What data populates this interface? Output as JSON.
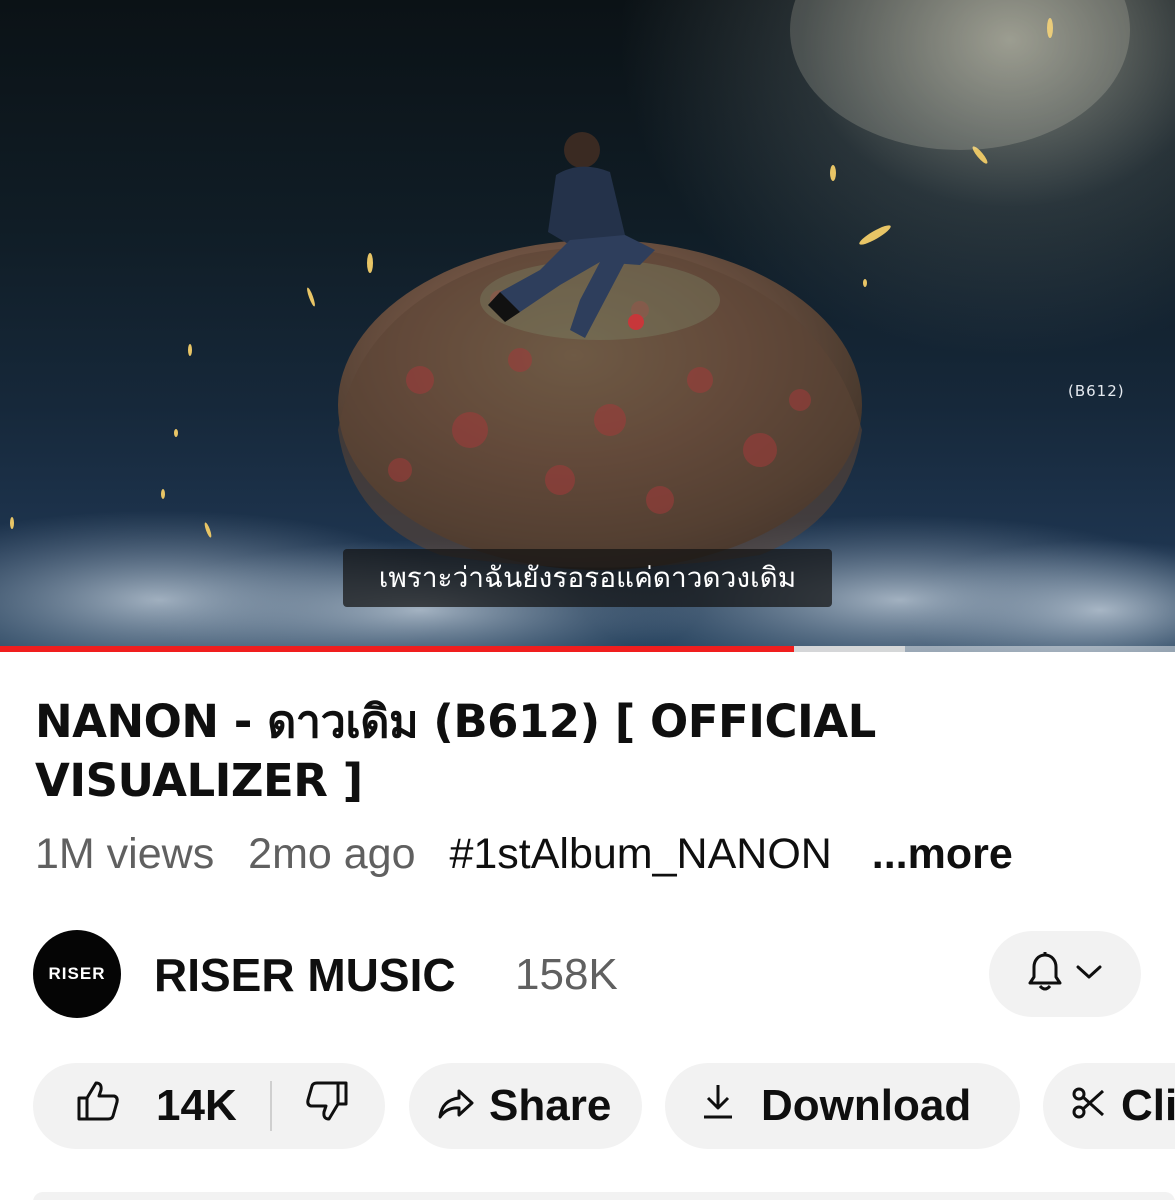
{
  "player": {
    "caption": "เพราะว่าฉันยังรอรอแค่ดาวดวงเดิม",
    "watermark": "(B612)",
    "progress": 0.676,
    "buffered": 0.77,
    "colors": {
      "progress": "#f01e1e"
    }
  },
  "video": {
    "title": "NANON - ดาวเดิม (B612) [ OFFICIAL VISUALIZER ]",
    "views": "1M views",
    "age": "2mo ago",
    "hashtag": "#1stAlbum_NANON",
    "more": "...more"
  },
  "channel": {
    "avatar_text": "RISER",
    "name": "RISER MUSIC",
    "subscribers": "158K",
    "bell_icon": "bell-icon",
    "chevron_icon": "chevron-down-icon"
  },
  "actions": {
    "like_count": "14K",
    "share_label": "Share",
    "download_label": "Download",
    "clip_label": "Cli"
  }
}
